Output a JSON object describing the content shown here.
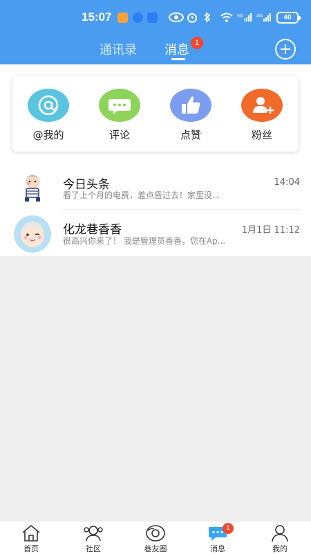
{
  "status_bar": {
    "time": "15:07",
    "battery": "40",
    "network_5g": "5G",
    "network_4g": "4G"
  },
  "header": {
    "tabs": [
      {
        "label": "通讯录",
        "active": false
      },
      {
        "label": "消息",
        "active": true,
        "badge": "1"
      }
    ],
    "add_icon": "plus-circle-icon"
  },
  "quick_actions": [
    {
      "label": "@我的",
      "icon": "at-icon",
      "color": "#5bc4e0"
    },
    {
      "label": "评论",
      "icon": "comment-icon",
      "color": "#8ed35a"
    },
    {
      "label": "点赞",
      "icon": "thumbs-up-icon",
      "color": "#7d9ef0"
    },
    {
      "label": "粉丝",
      "icon": "add-user-icon",
      "color": "#f06a2a"
    }
  ],
  "messages": [
    {
      "title": "今日头条",
      "preview": "看了上个月的电费，差点昏过去！家里没...",
      "time": "14:04"
    },
    {
      "title": "化龙巷香香",
      "preview": "很高兴你来了！ 我是管理员香香，您在Ap...",
      "time": "1月1日 11:12"
    }
  ],
  "bottom_nav": [
    {
      "label": "首页",
      "icon": "home-icon"
    },
    {
      "label": "社区",
      "icon": "community-icon"
    },
    {
      "label": "巷友圈",
      "icon": "moments-icon"
    },
    {
      "label": "消息",
      "icon": "message-icon",
      "badge": "1",
      "active": true
    },
    {
      "label": "我的",
      "icon": "profile-icon"
    }
  ]
}
